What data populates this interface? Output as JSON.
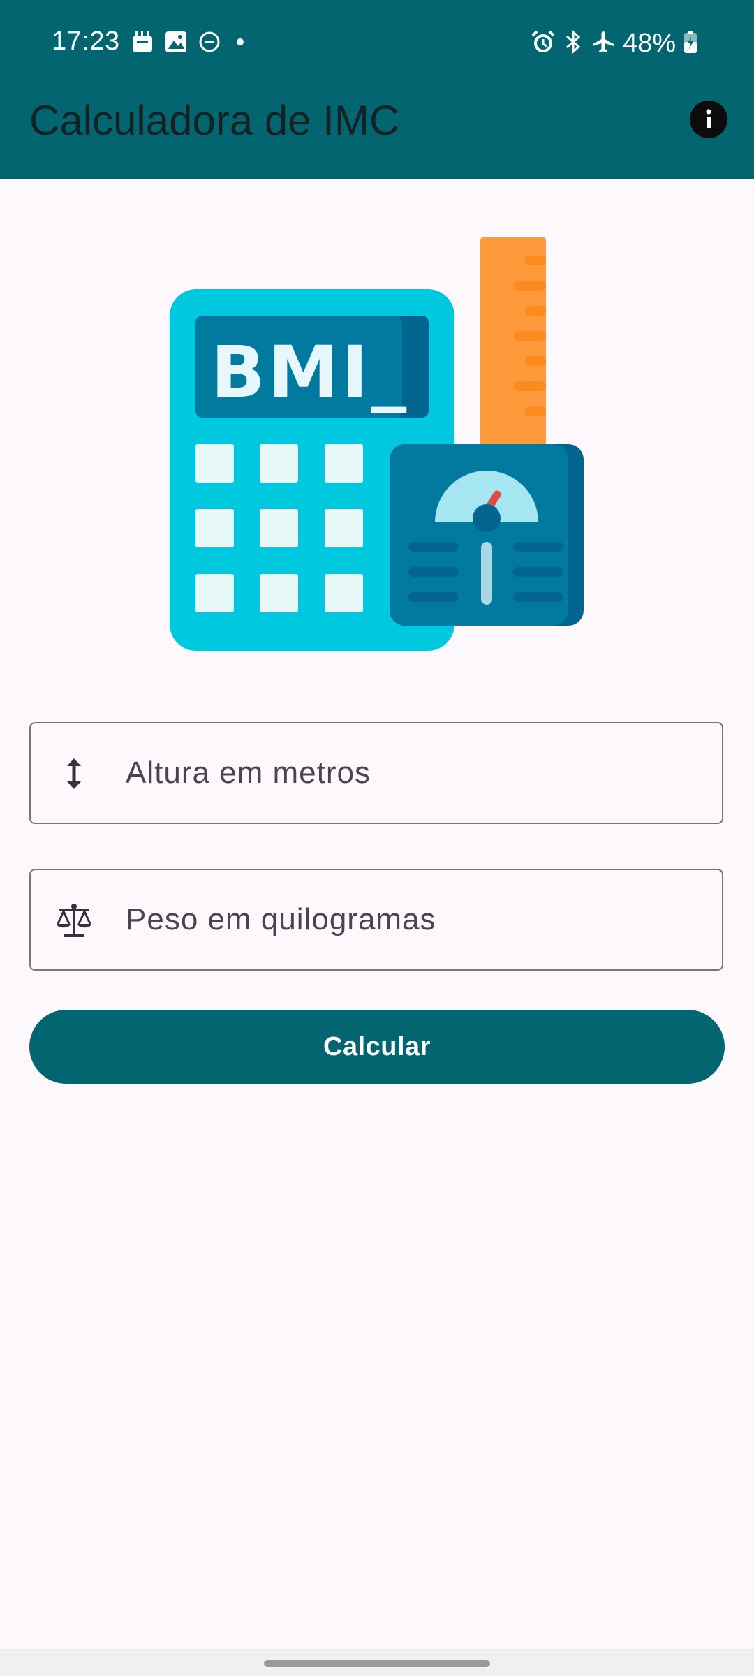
{
  "status_bar": {
    "time": "17:23",
    "battery": "48%",
    "left_icons": [
      "cast-icon",
      "image-icon",
      "dnd-icon",
      "dot-icon"
    ],
    "right_icons": [
      "alarm-icon",
      "bluetooth-icon",
      "airplane-icon",
      "battery-icon"
    ]
  },
  "app_bar": {
    "title": "Calculadora de IMC",
    "info_icon": "info-icon"
  },
  "illustration": {
    "screen_text": "BMI_"
  },
  "form": {
    "height_placeholder": "Altura em metros",
    "height_icon": "height-arrows-icon",
    "weight_placeholder": "Peso em quilogramas",
    "weight_icon": "scale-icon",
    "button_label": "Calcular"
  },
  "colors": {
    "primary": "#02656f",
    "background": "#fdf8fc",
    "outline": "#79747e"
  }
}
